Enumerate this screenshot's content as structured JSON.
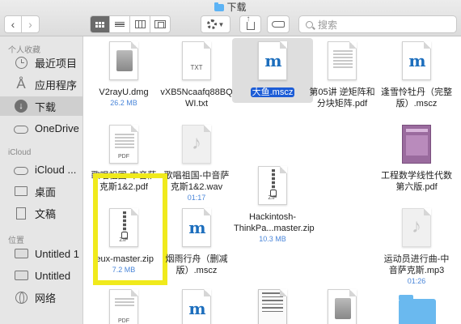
{
  "window": {
    "title": "下载"
  },
  "toolbar": {
    "search_placeholder": "搜索"
  },
  "sidebar": {
    "sections": [
      {
        "head": "个人收藏"
      },
      {
        "head": "iCloud"
      },
      {
        "head": "位置"
      }
    ],
    "items": [
      {
        "label": "最近项目",
        "icon": "clock-icon"
      },
      {
        "label": "应用程序",
        "icon": "apps-icon"
      },
      {
        "label": "下载",
        "icon": "download-icon",
        "active": true
      },
      {
        "label": "OneDrive",
        "icon": "cloud-icon"
      },
      {
        "label": "iCloud ...",
        "icon": "cloud-icon"
      },
      {
        "label": "桌面",
        "icon": "desktop-icon"
      },
      {
        "label": "文稿",
        "icon": "document-icon"
      },
      {
        "label": "Untitled 1",
        "icon": "drive-icon"
      },
      {
        "label": "Untitled",
        "icon": "drive-icon"
      },
      {
        "label": "网络",
        "icon": "network-icon"
      }
    ]
  },
  "files": [
    {
      "name1": "V2rayU.dmg",
      "name2": "",
      "meta": "26.2 MB",
      "type": "dmg"
    },
    {
      "name1": "vXB5Ncaafq88BQ",
      "name2": "WI.txt",
      "meta": "",
      "type": "txt",
      "badge": "TXT"
    },
    {
      "name1": "大鱼.mscz",
      "name2": "",
      "meta": "",
      "type": "mscz",
      "selected": true
    },
    {
      "name1": "第05讲 逆矩阵和",
      "name2": "分块矩阵.pdf",
      "meta": "",
      "type": "pdf"
    },
    {
      "name1": "逢雪怜牡丹（完整",
      "name2": "版）.mscz",
      "meta": "",
      "type": "mscz"
    },
    {
      "name1": "歌唱祖国-中音萨",
      "name2": "克斯1&2.pdf",
      "meta": "",
      "type": "pdf",
      "badge": "PDF"
    },
    {
      "name1": "歌唱祖国-中音萨",
      "name2": "克斯1&2.wav",
      "meta": "01:17",
      "type": "wav"
    },
    {
      "name1": "",
      "name2": "",
      "meta": "",
      "type": "zip-empty"
    },
    {
      "name1": "",
      "name2": "",
      "meta": "",
      "type": "hq"
    },
    {
      "name1": "工程数学线性代数",
      "name2": "第六版.pdf",
      "meta": "",
      "type": "purple"
    },
    {
      "name1": "ieux-master.zip",
      "name2": "",
      "meta": "7.2 MB",
      "type": "zip",
      "badge": "ZIP"
    },
    {
      "name1": "烟雨行舟（删减",
      "name2": "版）.mscz",
      "meta": "",
      "type": "mscz"
    },
    {
      "name1": "Hackintosh-",
      "name2": "ThinkPa...master.zip",
      "meta": "10.3 MB",
      "type": "zip",
      "badge": "ZIP"
    },
    {
      "name1": "运动员进行曲-中",
      "name2": "音萨克斯.mp3",
      "meta": "01:26",
      "type": "mp3"
    },
    {
      "name1": "",
      "name2": "",
      "meta": "",
      "type": "pdf",
      "badge": "PDF"
    },
    {
      "name1": "",
      "name2": "",
      "meta": "",
      "type": "mscz"
    },
    {
      "name1": "",
      "name2": "",
      "meta": "",
      "type": "hq"
    },
    {
      "name1": "",
      "name2": "",
      "meta": "",
      "type": "dmg"
    },
    {
      "name1": "",
      "name2": "",
      "meta": "",
      "type": "folder"
    }
  ],
  "colors": {
    "accent": "#1c5cd6",
    "highlight": "#f0ea1c",
    "meta": "#4a86d9"
  }
}
